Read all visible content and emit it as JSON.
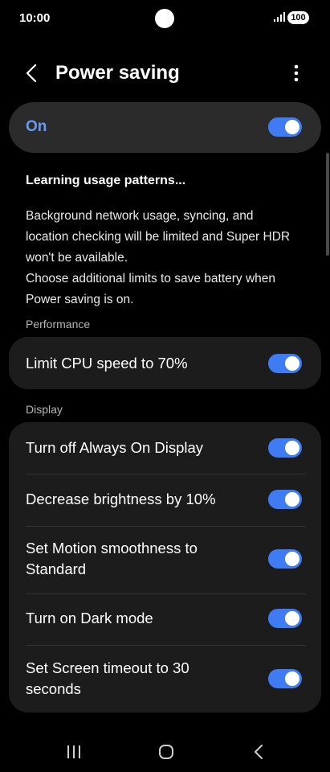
{
  "status_bar": {
    "time": "10:00",
    "battery": "100"
  },
  "header": {
    "title": "Power saving"
  },
  "master_switch": {
    "label": "On",
    "enabled": true
  },
  "info": {
    "heading": "Learning usage patterns...",
    "description_lines": [
      "Background network usage, syncing, and",
      "location checking will be limited and Super HDR",
      "won't be available.",
      "Choose additional limits to save battery when",
      "Power saving is on."
    ]
  },
  "performance": {
    "section_label": "Performance",
    "items": [
      {
        "label": "Limit CPU speed to 70%",
        "enabled": true
      }
    ]
  },
  "display": {
    "section_label": "Display",
    "items": [
      {
        "label": "Turn off Always On Display",
        "enabled": true
      },
      {
        "label": "Decrease brightness by 10%",
        "enabled": true
      },
      {
        "label_line1": "Set Motion smoothness to",
        "label_line2": "Standard",
        "enabled": true
      },
      {
        "label": "Turn on Dark mode",
        "enabled": true
      },
      {
        "label_line1": "Set Screen timeout to 30",
        "label_line2": "seconds",
        "enabled": true
      }
    ]
  },
  "colors": {
    "accent": "#3f7cf3",
    "on_label": "#6a9af2",
    "card": "#1c1c1c",
    "background": "#000000"
  },
  "icons": [
    "back-arrow-icon",
    "more-options-icon",
    "recent-apps-icon",
    "home-icon",
    "back-nav-icon",
    "signal-icon",
    "battery-icon"
  ]
}
